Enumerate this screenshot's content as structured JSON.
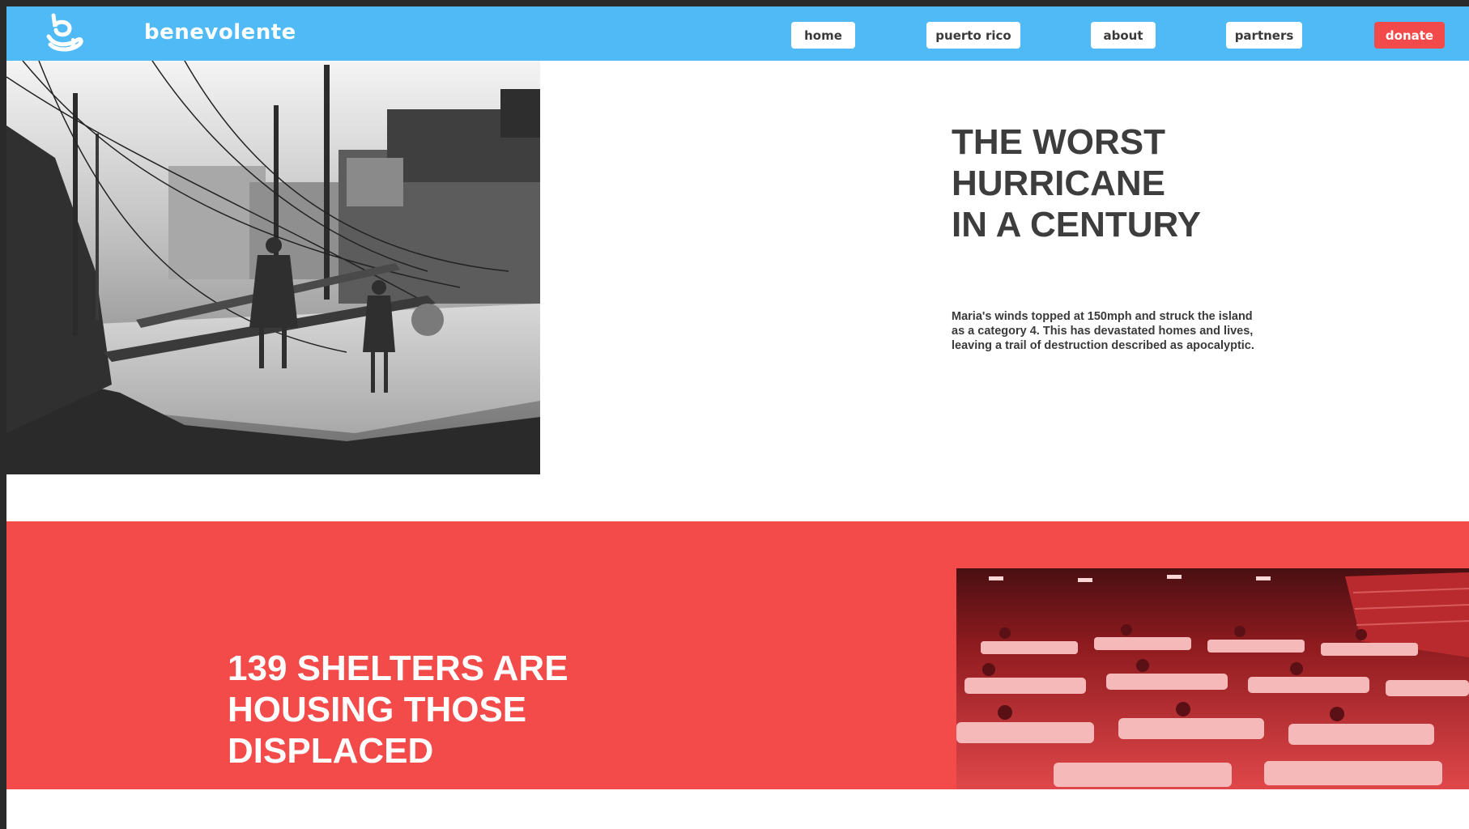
{
  "brand": {
    "name": "benevolente",
    "logo_icon": "hand-b-logo-icon"
  },
  "nav": {
    "items": [
      {
        "label": "home"
      },
      {
        "label": "puerto rico"
      },
      {
        "label": "about"
      },
      {
        "label": "partners"
      }
    ],
    "donate_label": "donate"
  },
  "colors": {
    "nav_bg": "#4fbaf6",
    "accent_red": "#f24b4a",
    "heading_gray": "#3d3d3d"
  },
  "hero": {
    "headline_lines": [
      "THE WORST",
      "HURRICANE",
      "IN A CENTURY"
    ],
    "body": "Maria's winds topped at 150mph and struck the island as a category 4. This has devastated homes and lives, leaving a trail of destruction described as apocalyptic.",
    "photo": "hurricane-aftermath-photo"
  },
  "shelters": {
    "headline_lines": [
      "139 SHELTERS ARE",
      "HOUSING THOSE",
      "DISPLACED"
    ],
    "photo": "shelter-cots-photo"
  }
}
